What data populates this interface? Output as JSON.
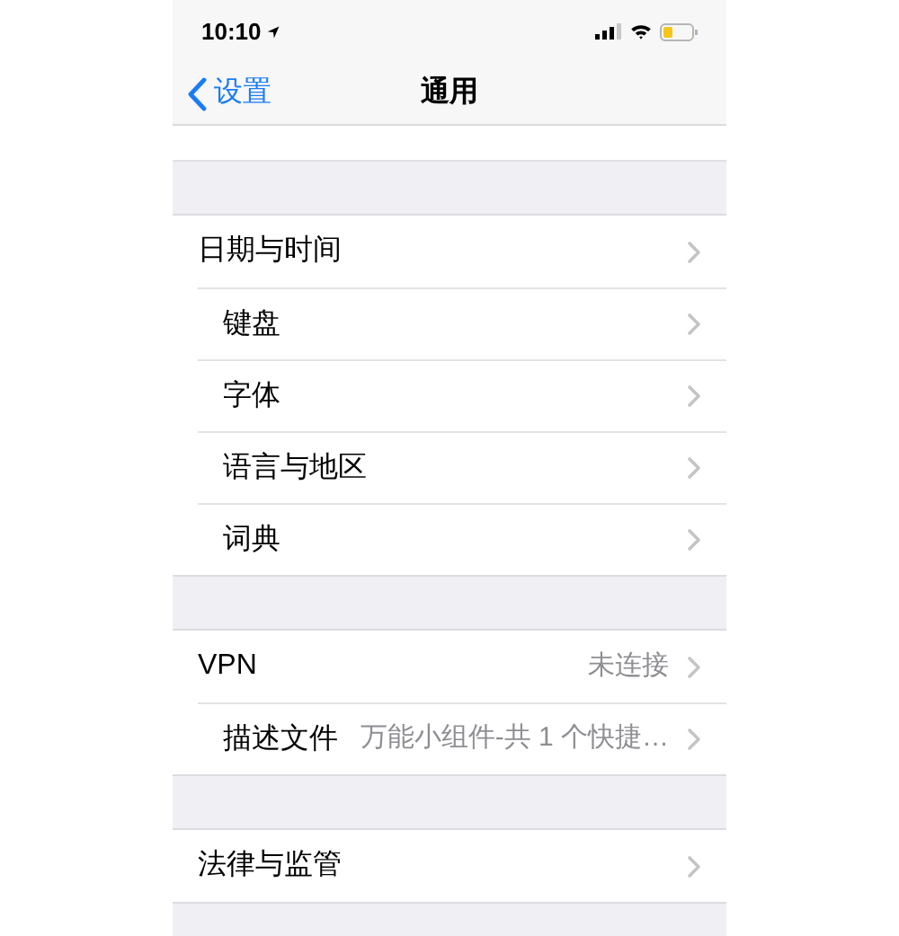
{
  "status_bar": {
    "time": "10:10"
  },
  "nav_bar": {
    "back": "设置",
    "title": "通用"
  },
  "sections": [
    {
      "rows": [
        {
          "label": "日期与时间"
        },
        {
          "label": "键盘"
        },
        {
          "label": "字体"
        },
        {
          "label": "语言与地区"
        },
        {
          "label": "词典"
        }
      ]
    },
    {
      "rows": [
        {
          "label": "VPN",
          "value": "未连接"
        },
        {
          "label": "描述文件",
          "value": "万能小组件-共 1 个快捷…"
        }
      ]
    },
    {
      "rows": [
        {
          "label": "法律与监管"
        }
      ]
    }
  ]
}
